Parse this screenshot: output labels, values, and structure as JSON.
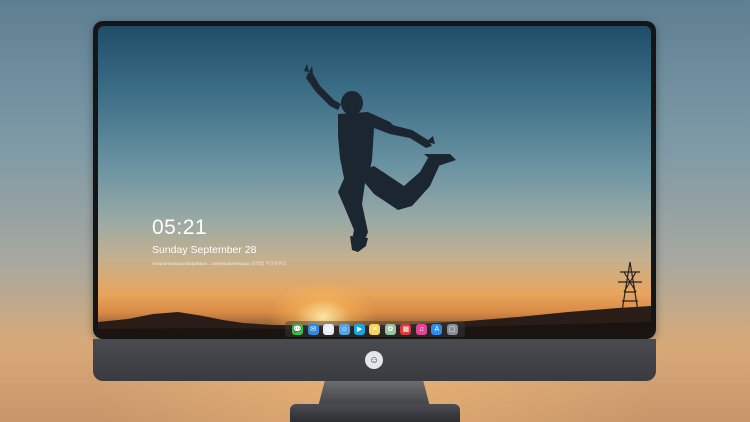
{
  "lock_screen": {
    "time": "05:21",
    "date": "Sunday September  28",
    "subtitle": "Ankaranoeisyaoodatjulkaan...ooeisytyaooeisyaoo 옹박옹  두다아우다"
  },
  "dock": {
    "apps": [
      {
        "name": "messages-icon",
        "color": "#3dbb4f",
        "glyph": "💬"
      },
      {
        "name": "mail-icon",
        "color": "#2f8be0",
        "glyph": "✉"
      },
      {
        "name": "safari-icon",
        "color": "#e9edf2",
        "glyph": "◎"
      },
      {
        "name": "finder-icon",
        "color": "#53a4e8",
        "glyph": "☺"
      },
      {
        "name": "video-icon",
        "color": "#1aa6e0",
        "glyph": "▶"
      },
      {
        "name": "notes-icon",
        "color": "#f4d35e",
        "glyph": "≡"
      },
      {
        "name": "photos-icon",
        "color": "#9bc3a0",
        "glyph": "✿"
      },
      {
        "name": "calendar-icon",
        "color": "#d93b3b",
        "glyph": "▦"
      },
      {
        "name": "itunes-icon",
        "color": "#e0459b",
        "glyph": "♫"
      },
      {
        "name": "appstore-icon",
        "color": "#2c8cf0",
        "glyph": "A"
      },
      {
        "name": "trash-icon",
        "color": "#8a8d93",
        "glyph": "▢"
      }
    ]
  },
  "monitor": {
    "logo_icon": "user-avatar-icon"
  }
}
